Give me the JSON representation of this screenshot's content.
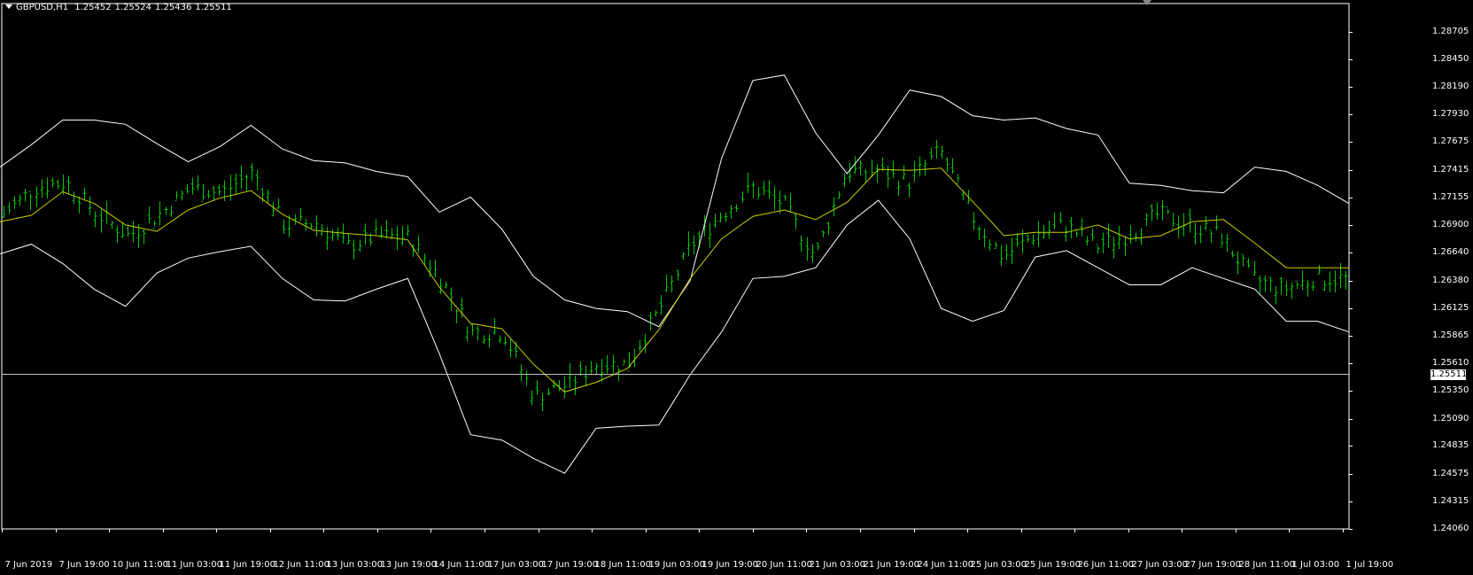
{
  "header": {
    "symbol": "GBPUSD,H1",
    "open": "1.25452",
    "high": "1.25524",
    "low": "1.25436",
    "close": "1.25511"
  },
  "colors": {
    "background": "#000000",
    "bars": "#00c800",
    "bands": "#ffffff",
    "middle_band": "#cccc00",
    "price_line": "#c0c0c0",
    "axis_text": "#ffffff"
  },
  "chart_data": {
    "type": "line",
    "title": "",
    "ylim": [
      1.2406,
      1.2896
    ],
    "grid": false,
    "current_price": 1.25511,
    "current_price_label": "1.25511",
    "y_ticks": [
      "1.28705",
      "1.28450",
      "1.28190",
      "1.27930",
      "1.27675",
      "1.27415",
      "1.27155",
      "1.26900",
      "1.26640",
      "1.26380",
      "1.26125",
      "1.25865",
      "1.25610",
      "1.25350",
      "1.25090",
      "1.24835",
      "1.24575",
      "1.24315",
      "1.24060"
    ],
    "x_ticks": [
      "7 Jun 2019",
      "7 Jun 19:00",
      "10 Jun 11:00",
      "11 Jun 03:00",
      "11 Jun 19:00",
      "12 Jun 11:00",
      "13 Jun 03:00",
      "13 Jun 19:00",
      "14 Jun 11:00",
      "17 Jun 03:00",
      "17 Jun 19:00",
      "18 Jun 11:00",
      "19 Jun 03:00",
      "19 Jun 19:00",
      "20 Jun 11:00",
      "21 Jun 03:00",
      "21 Jun 19:00",
      "24 Jun 11:00",
      "25 Jun 03:00",
      "25 Jun 19:00",
      "26 Jun 11:00",
      "27 Jun 03:00",
      "27 Jun 19:00",
      "28 Jun 11:00",
      "1 Jul 03:00",
      "1 Jul 19:00"
    ],
    "series": [
      {
        "name": "Upper Band",
        "values": [
          1.2744,
          1.2765,
          1.2788,
          1.2788,
          1.2784,
          1.2766,
          1.2749,
          1.2763,
          1.2783,
          1.2761,
          1.275,
          1.2748,
          1.274,
          1.2735,
          1.2702,
          1.2716,
          1.2686,
          1.2642,
          1.262,
          1.2612,
          1.2609,
          1.2595,
          1.2638,
          1.2752,
          1.2825,
          1.283,
          1.2776,
          1.2738,
          1.2774,
          1.2816,
          1.281,
          1.2792,
          1.2788,
          1.279,
          1.278,
          1.2774,
          1.2729,
          1.2727,
          1.2722,
          1.272,
          1.2744,
          1.274,
          1.2727,
          1.271
        ]
      },
      {
        "name": "Middle Band",
        "values": [
          1.2693,
          1.2699,
          1.2721,
          1.271,
          1.269,
          1.2684,
          1.2704,
          1.2715,
          1.2722,
          1.27,
          1.2685,
          1.2682,
          1.268,
          1.2676,
          1.2632,
          1.2598,
          1.2593,
          1.256,
          1.2534,
          1.2543,
          1.2556,
          1.2592,
          1.264,
          1.2677,
          1.2698,
          1.2704,
          1.2695,
          1.2711,
          1.2742,
          1.2741,
          1.2743,
          1.2712,
          1.268,
          1.2683,
          1.2683,
          1.269,
          1.2677,
          1.268,
          1.2693,
          1.2695,
          1.2673,
          1.265,
          1.265,
          1.265
        ]
      },
      {
        "name": "Lower Band",
        "values": [
          1.2663,
          1.2672,
          1.2654,
          1.263,
          1.2614,
          1.2645,
          1.2659,
          1.2665,
          1.267,
          1.264,
          1.262,
          1.2619,
          1.263,
          1.264,
          1.257,
          1.2494,
          1.2489,
          1.2472,
          1.2458,
          1.25,
          1.2502,
          1.2503,
          1.255,
          1.259,
          1.264,
          1.2642,
          1.265,
          1.269,
          1.2713,
          1.2677,
          1.2612,
          1.26,
          1.261,
          1.266,
          1.2666,
          1.265,
          1.2634,
          1.2634,
          1.265,
          1.264,
          1.263,
          1.26,
          1.26,
          1.259
        ]
      },
      {
        "name": "Close",
        "values": [
          1.27,
          1.2725,
          1.273,
          1.27,
          1.268,
          1.27,
          1.2725,
          1.272,
          1.274,
          1.269,
          1.2692,
          1.267,
          1.268,
          1.2678,
          1.264,
          1.259,
          1.259,
          1.253,
          1.254,
          1.256,
          1.256,
          1.261,
          1.267,
          1.27,
          1.2725,
          1.271,
          1.266,
          1.274,
          1.274,
          1.273,
          1.276,
          1.27,
          1.266,
          1.268,
          1.269,
          1.267,
          1.268,
          1.27,
          1.269,
          1.268,
          1.264,
          1.263,
          1.264,
          1.264
        ]
      }
    ]
  }
}
